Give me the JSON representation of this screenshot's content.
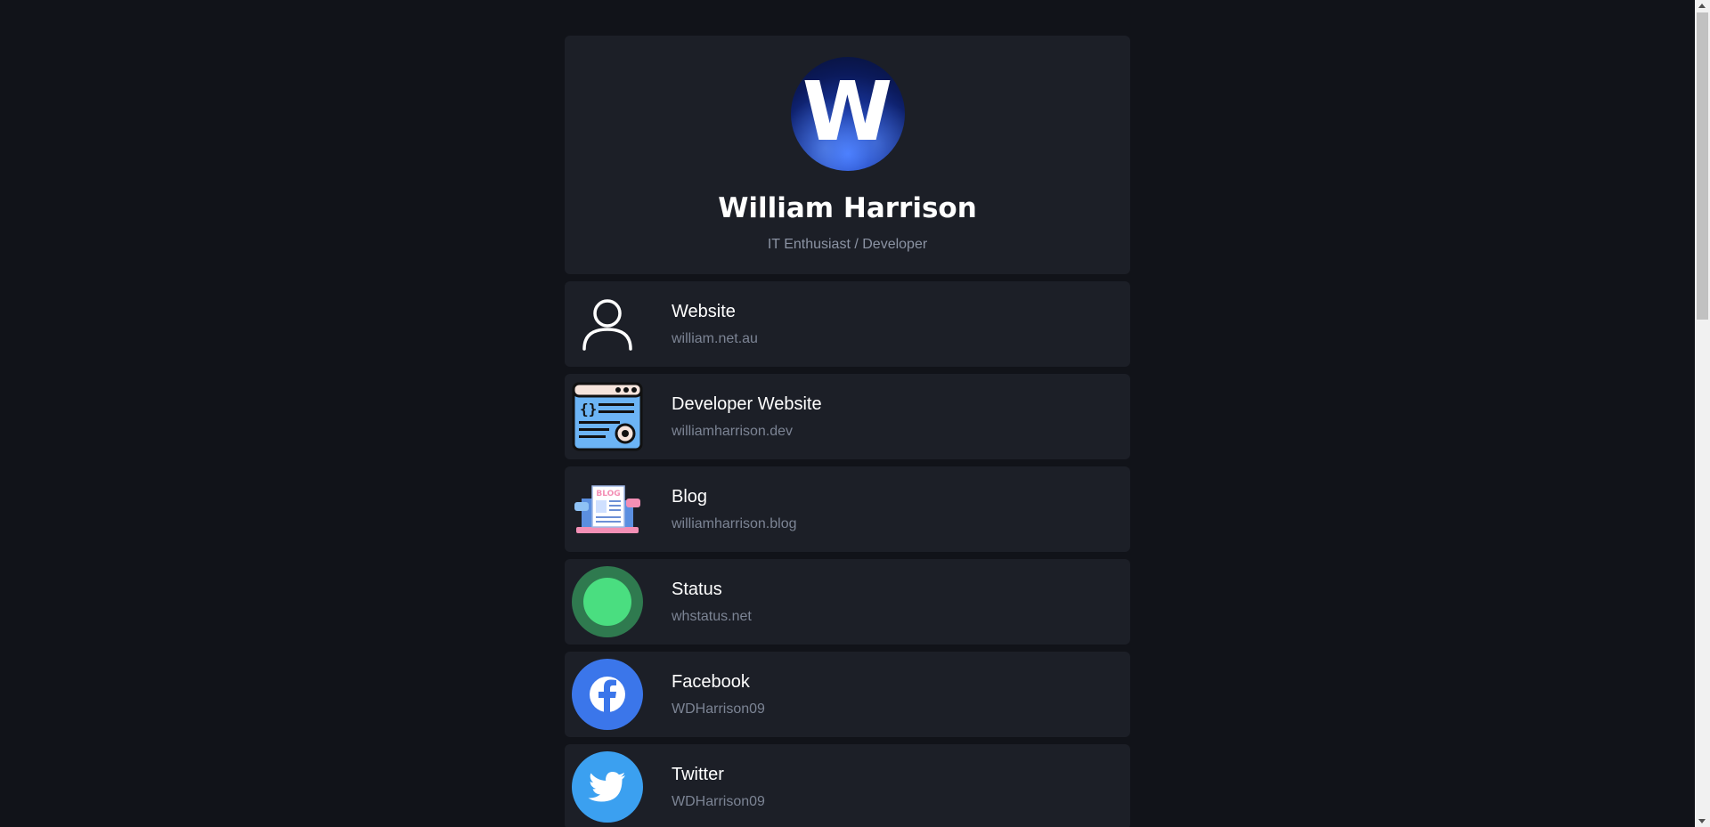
{
  "profile": {
    "avatar_letter": "W",
    "name": "William Harrison",
    "tagline": "IT Enthusiast / Developer"
  },
  "links": [
    {
      "title": "Website",
      "subtitle": "william.net.au",
      "icon": "person-icon"
    },
    {
      "title": "Developer Website",
      "subtitle": "williamharrison.dev",
      "icon": "code-window-icon"
    },
    {
      "title": "Blog",
      "subtitle": "williamharrison.blog",
      "icon": "blog-icon"
    },
    {
      "title": "Status",
      "subtitle": "whstatus.net",
      "icon": "status-dot-icon"
    },
    {
      "title": "Facebook",
      "subtitle": "WDHarrison09",
      "icon": "facebook-icon"
    },
    {
      "title": "Twitter",
      "subtitle": "WDHarrison09",
      "icon": "twitter-icon"
    }
  ],
  "colors": {
    "background": "#111319",
    "card": "#1c1f27",
    "status_green": "#4ade80",
    "facebook_blue": "#3b76ea",
    "twitter_blue": "#3ba0f0"
  }
}
